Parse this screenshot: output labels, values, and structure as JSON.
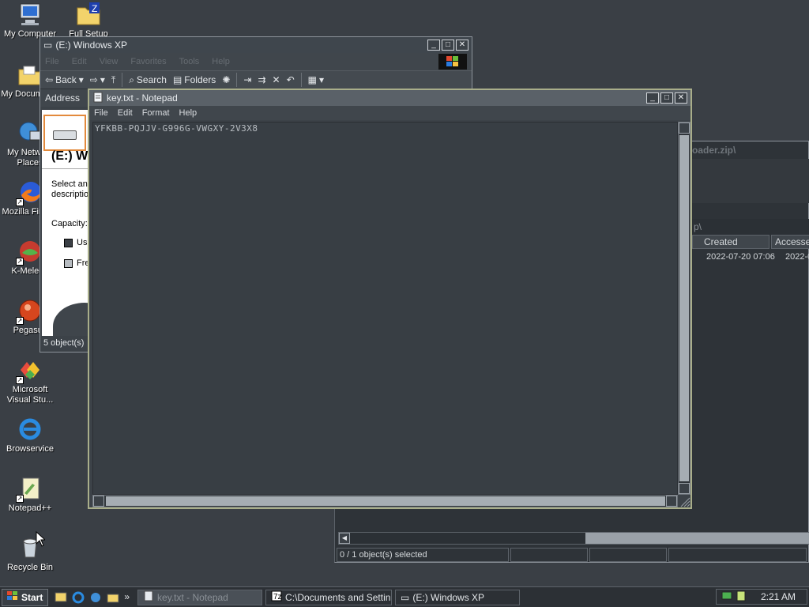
{
  "desktop": {
    "icons": [
      {
        "label": "My Computer"
      },
      {
        "label": "Full Setup"
      },
      {
        "label": "My Documents"
      },
      {
        "label": "My Network Places"
      },
      {
        "label": "Mozilla Firefox"
      },
      {
        "label": "K-Meleon"
      },
      {
        "label": "Pegasus"
      },
      {
        "label": "Microsoft Visual Stu..."
      },
      {
        "label": "Browservice"
      },
      {
        "label": "Notepad++"
      },
      {
        "label": "Recycle Bin"
      }
    ]
  },
  "explorer": {
    "title": "(E:) Windows XP",
    "menu": [
      "File",
      "Edit",
      "View",
      "Favorites",
      "Tools",
      "Help"
    ],
    "toolbar": {
      "back": "Back",
      "search": "Search",
      "folders": "Folders"
    },
    "address_label": "Address",
    "panel": {
      "drive_title": "(E:) Windows XP",
      "description": "Select an item to view its description.",
      "capacity_label": "Capacity:",
      "used_label": "Used",
      "free_label": "Free"
    },
    "status": "5 object(s)"
  },
  "zip": {
    "title_fragment": "oader.zip\\",
    "address_fragment": "p\\",
    "columns": [
      "Created",
      "Accessed"
    ],
    "row": {
      "created": "2022-07-20 07:06",
      "accessed": "2022-0"
    },
    "status": "0 / 1 object(s) selected"
  },
  "notepad": {
    "title": "key.txt - Notepad",
    "menu": [
      "File",
      "Edit",
      "Format",
      "Help"
    ],
    "content": "YFKBB-PQJJV-G996G-VWGXY-2V3X8"
  },
  "taskbar": {
    "start": "Start",
    "tasks": [
      "key.txt - Notepad",
      "C:\\Documents and Settin...",
      "(E:) Windows XP"
    ],
    "clock": "2:21 AM"
  },
  "colors": {
    "desktop_bg": "#3a3f45",
    "window_bg": "#3c4248",
    "notepad_border": "#a9ae8a",
    "text": "#d6d9dc"
  }
}
